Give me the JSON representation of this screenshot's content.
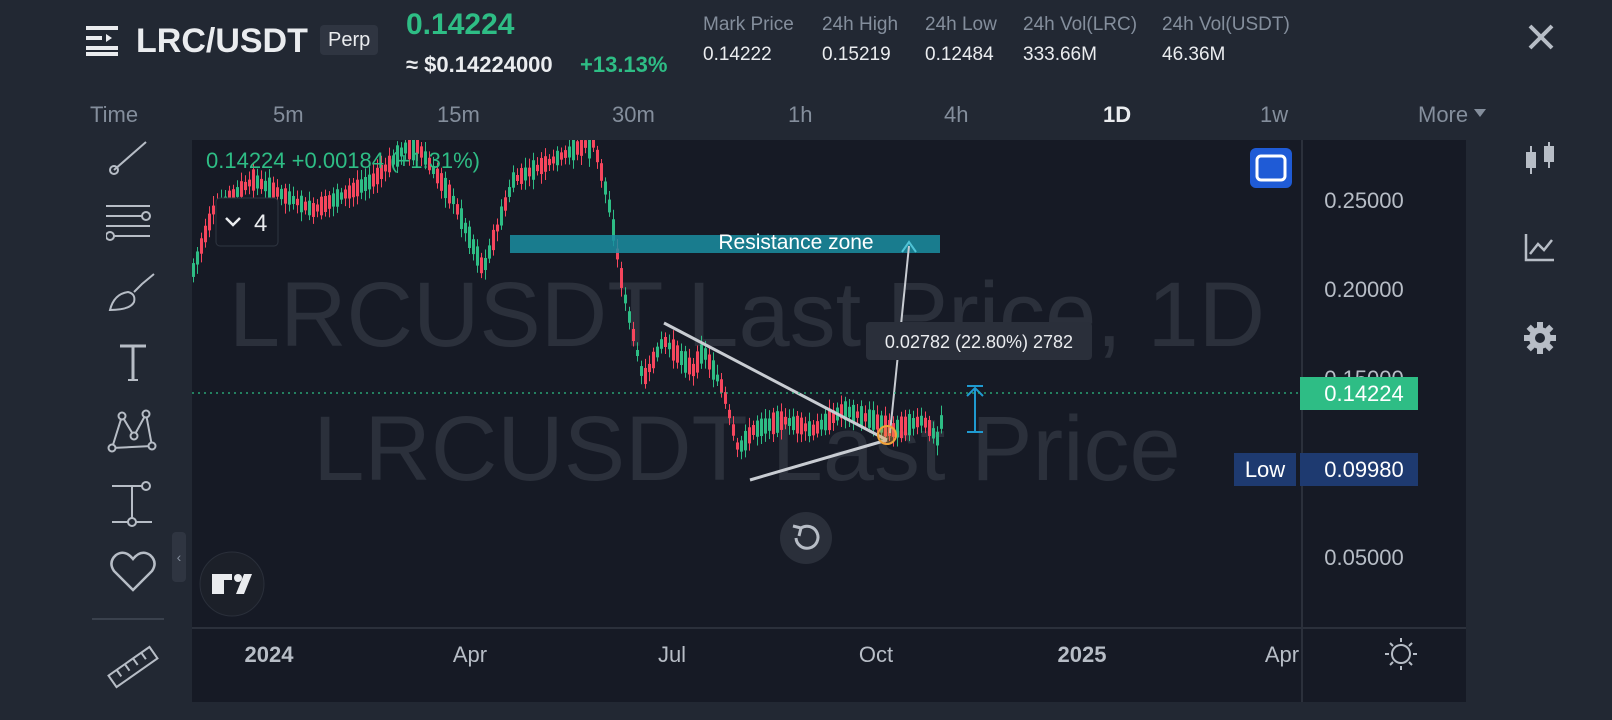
{
  "header": {
    "pair": "LRC/USDT",
    "contract_type": "Perp",
    "last_price": "0.14224",
    "usd_price": "≈ $0.14224000",
    "change_pct": "+13.13%",
    "stats": [
      {
        "label": "Mark Price",
        "value": "0.14222"
      },
      {
        "label": "24h High",
        "value": "0.15219"
      },
      {
        "label": "24h Low",
        "value": "0.12484"
      },
      {
        "label": "24h Vol(LRC)",
        "value": "333.66M"
      },
      {
        "label": "24h Vol(USDT)",
        "value": "46.36M"
      }
    ]
  },
  "timeframes": [
    "Time",
    "5m",
    "15m",
    "30m",
    "1h",
    "4h",
    "1D",
    "1w",
    "More"
  ],
  "active_timeframe": "1D",
  "tools": [
    "trend-line-tool",
    "fib-retracement-tool",
    "brush-tool",
    "text-tool",
    "pattern-tool",
    "measure-tool",
    "favorites-heart",
    "ruler-tool"
  ],
  "chart": {
    "legend": "0.14224  +0.00184 (+1.31%)",
    "indicator_count": "4",
    "watermark_line1": "LRCUSDT Last Price, 1D",
    "watermark_line2": "LRCUSDT Last Price",
    "resistance_label": "Resistance zone",
    "measure_label": "0.02782 (22.80%) 2782",
    "price_axis": [
      "0.25000",
      "0.20000",
      "0.15000",
      "0.05000"
    ],
    "current_price_tag": "0.14224",
    "low_label": "Low",
    "low_value": "0.09980",
    "time_axis": [
      "2024",
      "Apr",
      "Jul",
      "Oct",
      "2025",
      "Apr"
    ],
    "time_axis_bold": [
      "2024",
      "2025"
    ]
  },
  "colors": {
    "up": "#2ebd85",
    "down": "#f6465d",
    "resistance": "#1a9bb0",
    "low_tag": "#1e3a70",
    "accent_blue": "#1f5bd6"
  }
}
